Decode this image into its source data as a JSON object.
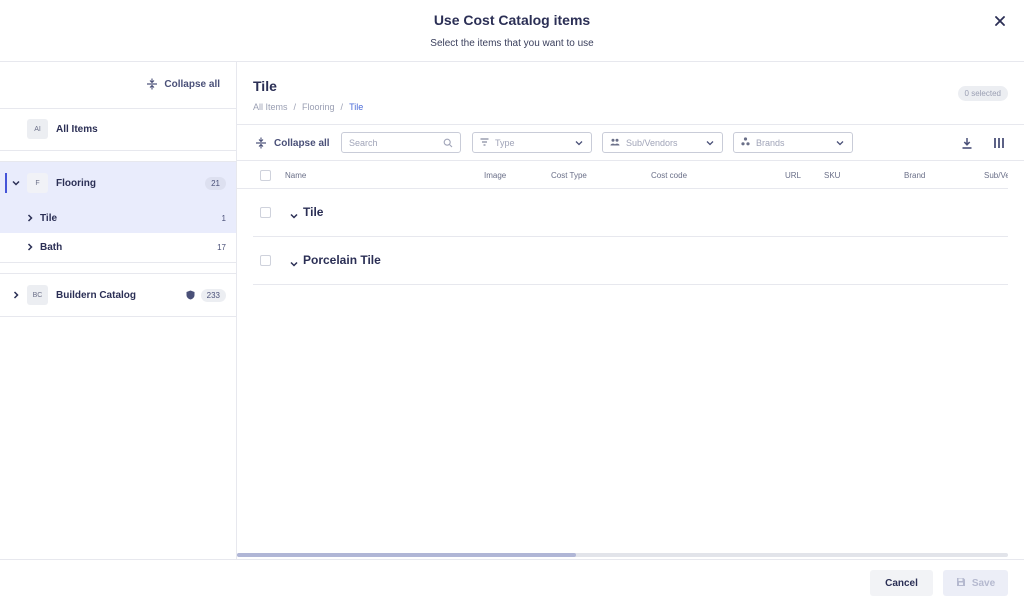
{
  "dialog": {
    "title": "Use Cost Catalog items",
    "subtitle": "Select the items that you want to use",
    "close_icon": "close-icon"
  },
  "sidebar": {
    "collapse_label": "Collapse all",
    "all_items": {
      "avatar": "AI",
      "label": "All Items"
    },
    "groups": [
      {
        "avatar": "F",
        "label": "Flooring",
        "count": "21",
        "expanded": true,
        "children": [
          {
            "label": "Tile",
            "count": "1",
            "active": true
          },
          {
            "label": "Bath",
            "count": "17"
          }
        ]
      },
      {
        "avatar": "BC",
        "label": "Buildern Catalog",
        "count": "233",
        "icon": "shield-icon",
        "expanded": false
      }
    ],
    "accent_color": "#4554d8",
    "active_bg": "#e9ecfc"
  },
  "main": {
    "title": "Tile",
    "breadcrumb": [
      "All Items",
      "Flooring",
      "Tile"
    ],
    "breadcrumb_sep": "/",
    "selected_badge": "0 selected",
    "toolbar": {
      "collapse_label": "Collapse all",
      "search_placeholder": "Search",
      "type_placeholder": "Type",
      "vendors_placeholder": "Sub/Vendors",
      "brands_placeholder": "Brands",
      "download_icon": "download-icon",
      "columns_icon": "columns-icon"
    },
    "columns": [
      "Name",
      "Image",
      "Cost Type",
      "Cost code",
      "URL",
      "SKU",
      "Brand",
      "Sub/Ve"
    ],
    "groups": [
      {
        "label": "Tile"
      },
      {
        "label": "Porcelain Tile"
      }
    ]
  },
  "footer": {
    "cancel_label": "Cancel",
    "save_label": "Save"
  }
}
